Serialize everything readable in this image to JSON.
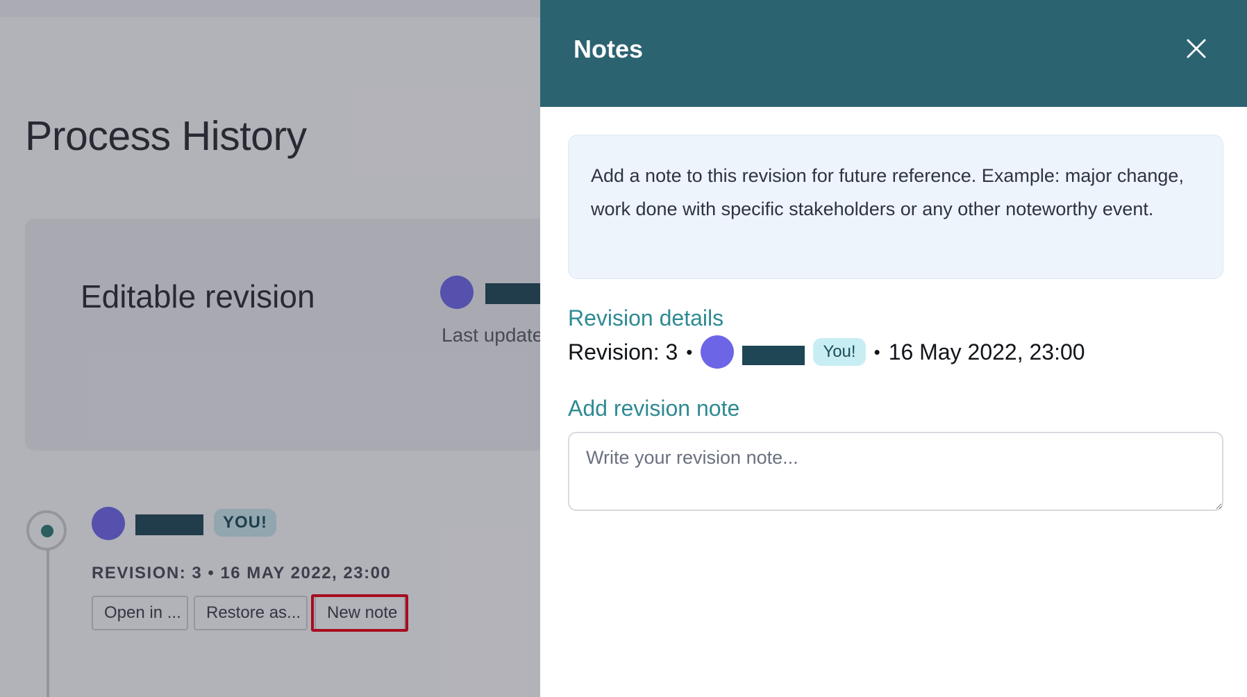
{
  "background": {
    "page_title": "Process History",
    "card": {
      "title": "Editable revision",
      "last_updated_label": "Last update"
    },
    "entry": {
      "you_badge": "YOU!",
      "meta": "REVISION: 3 • 16 MAY 2022, 23:00",
      "buttons": {
        "open": "Open in ...",
        "restore": "Restore as...",
        "new_note": "New note"
      }
    }
  },
  "panel": {
    "title": "Notes",
    "close_icon": "close-icon",
    "info_text": "Add a note to this revision for future reference. Example: major change, work done with specific stakeholders or any other noteworthy event.",
    "revision_details_heading": "Revision details",
    "revision_label": "Revision: 3",
    "separator": "•",
    "you_badge": "You!",
    "date": "16 May 2022, 23:00",
    "add_note_heading": "Add revision note",
    "note_placeholder": "Write your revision note...",
    "note_value": ""
  },
  "colors": {
    "header": "#2c6371",
    "accent": "#2e8a93",
    "avatar": "#6c66e6",
    "highlight": "#e60012"
  }
}
